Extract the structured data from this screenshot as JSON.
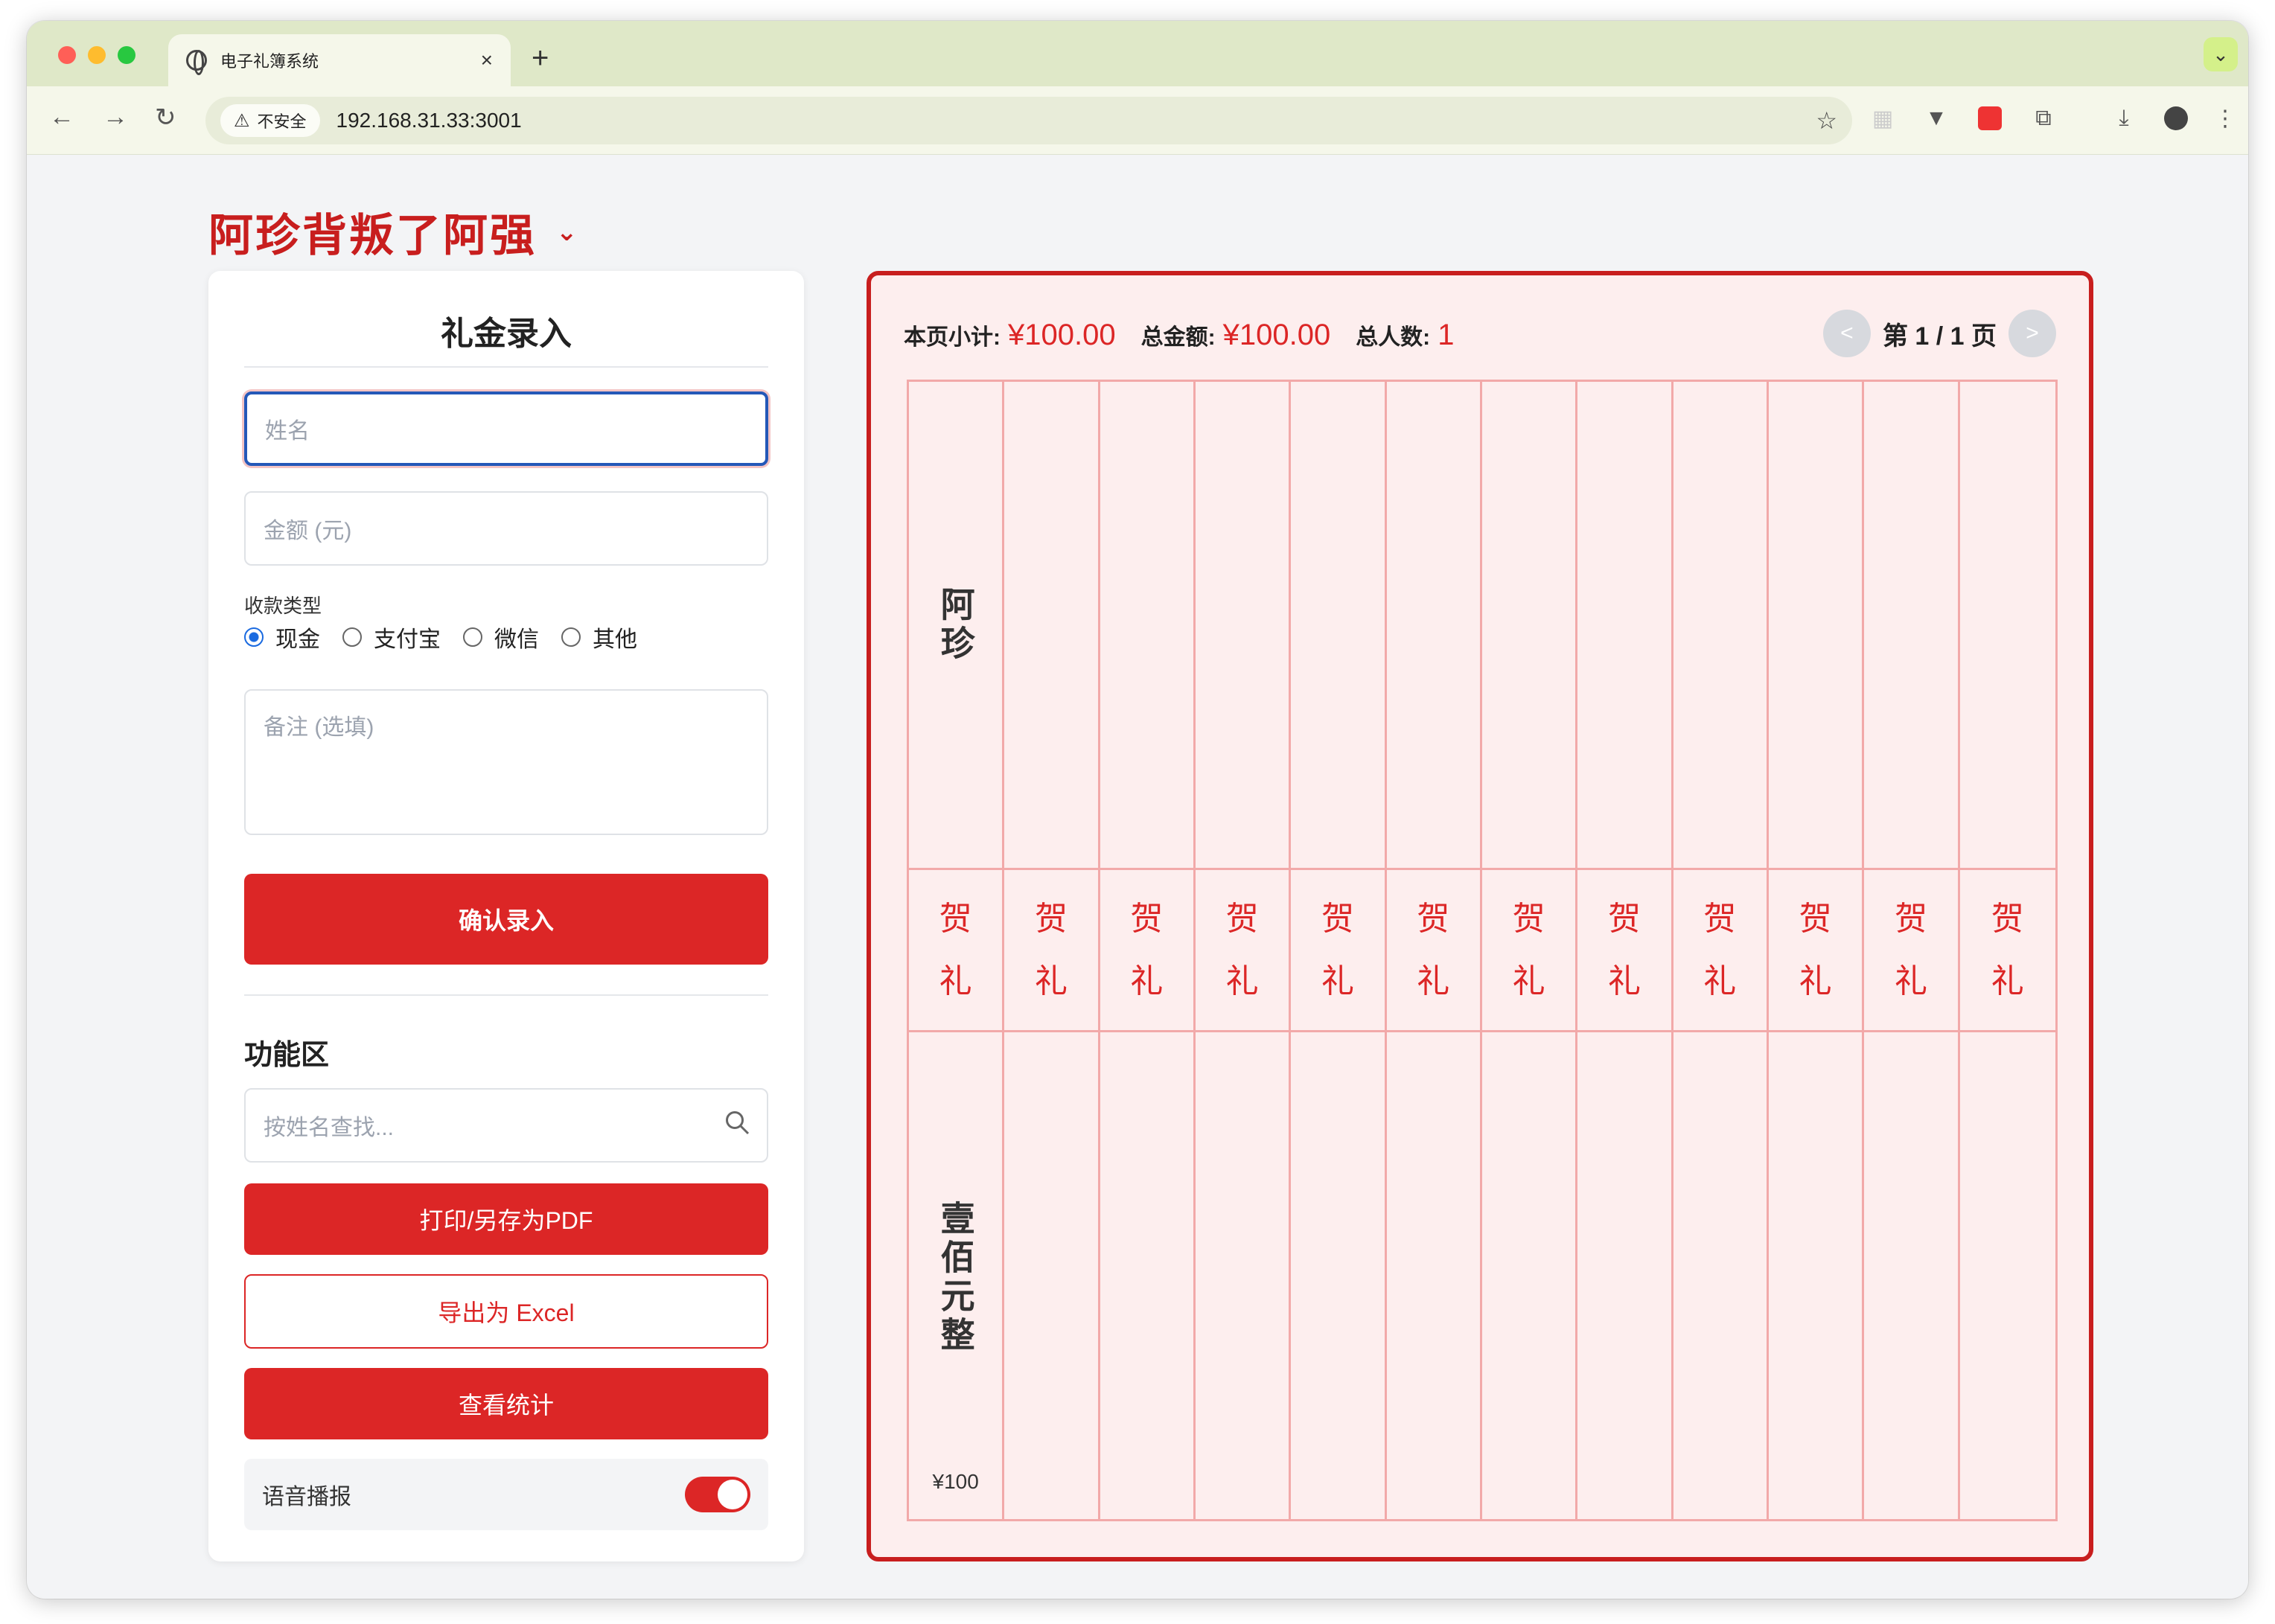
{
  "browser": {
    "tab_title": "电子礼簿系统",
    "tab_close": "×",
    "new_tab": "+",
    "security_label": "不安全",
    "url": "192.168.31.33:3001"
  },
  "event": {
    "title": "阿珍背叛了阿强",
    "caret": "⌄"
  },
  "form": {
    "heading": "礼金录入",
    "name_placeholder": "姓名",
    "amount_placeholder": "金额 (元)",
    "payment_label": "收款类型",
    "payment_options": [
      "现金",
      "支付宝",
      "微信",
      "其他"
    ],
    "payment_selected": "现金",
    "note_placeholder": "备注 (选填)",
    "submit_label": "确认录入"
  },
  "functions": {
    "heading": "功能区",
    "search_placeholder": "按姓名查找...",
    "print_label": "打印/另存为PDF",
    "export_label": "导出为 Excel",
    "stats_label": "查看统计",
    "voice_label": "语音播报",
    "voice_on": true
  },
  "book": {
    "page_subtotal_label": "本页小计:",
    "page_subtotal": "¥100.00",
    "total_amount_label": "总金额:",
    "total_amount": "¥100.00",
    "total_people_label": "总人数:",
    "total_people": "1",
    "pager_prev": "<",
    "pager_next": ">",
    "pager_text": "第 1 / 1 页",
    "gift_char_1": "贺",
    "gift_char_2": "礼",
    "entries": [
      {
        "name": "阿珍",
        "amount_words": "壹佰元整",
        "amount_num": "¥100"
      }
    ],
    "columns": 12
  },
  "colors": {
    "accent": "#dc2626",
    "book_bg": "#fdeeee",
    "grid_line": "#f2a9a9"
  }
}
